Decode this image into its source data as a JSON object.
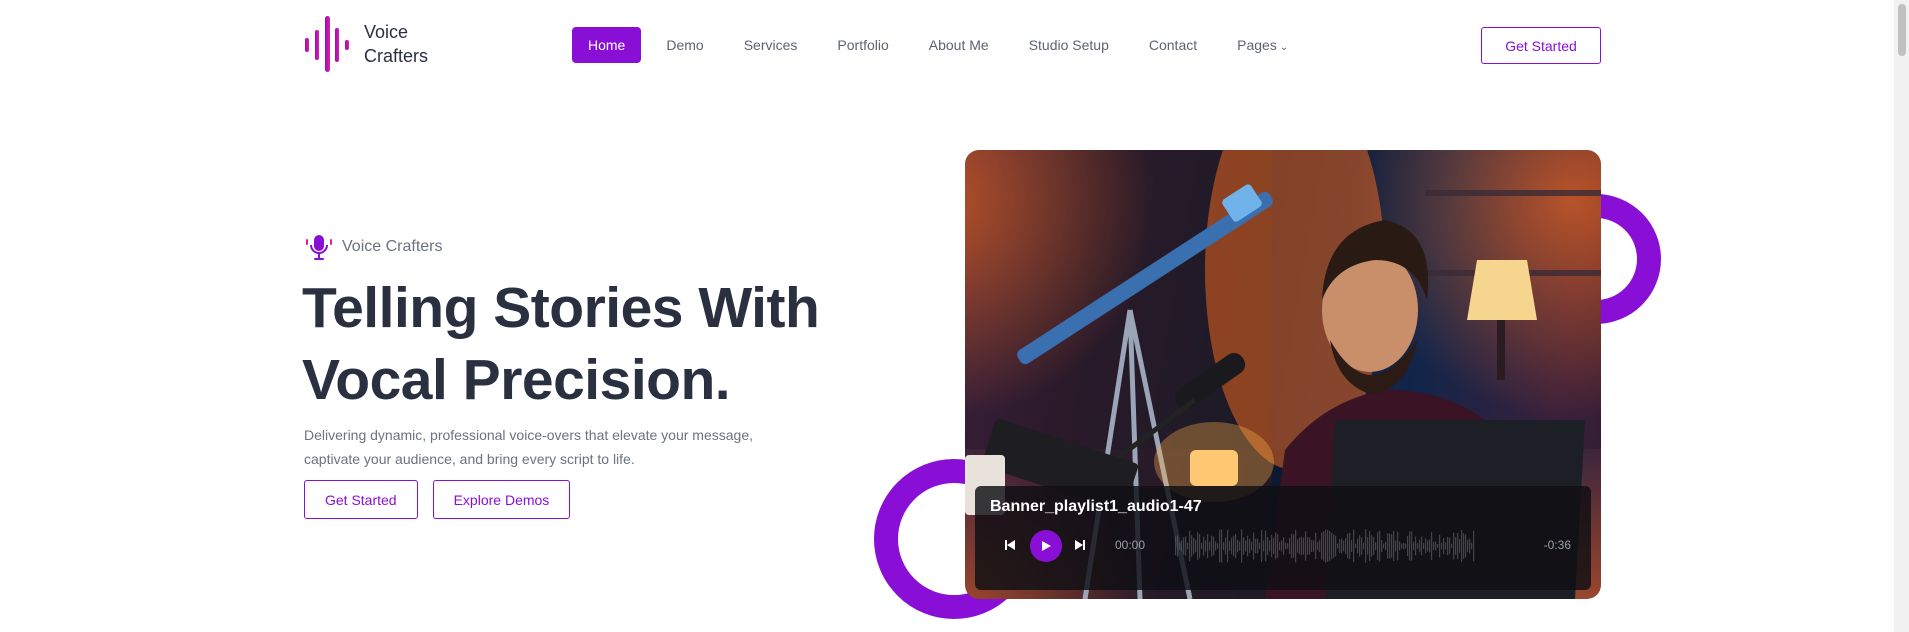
{
  "brand": {
    "name_line1": "Voice",
    "name_line2": "Crafters",
    "accent": "#8a0fd6",
    "accent_pink": "#e91e8c"
  },
  "nav": {
    "items": [
      {
        "label": "Home",
        "active": true
      },
      {
        "label": "Demo"
      },
      {
        "label": "Services"
      },
      {
        "label": "Portfolio"
      },
      {
        "label": "About Me"
      },
      {
        "label": "Studio Setup"
      },
      {
        "label": "Contact"
      },
      {
        "label": "Pages",
        "has_dropdown": true
      }
    ],
    "cta_label": "Get Started"
  },
  "hero": {
    "eyebrow": "Voice Crafters",
    "title_line1": "Telling Stories With",
    "title_line2": "Vocal Precision.",
    "subtitle_line1": "Delivering dynamic, professional voice-overs that elevate your message,",
    "subtitle_line2": "captivate your audience, and bring every script to life.",
    "primary_cta": "Get Started",
    "secondary_cta": "Explore Demos"
  },
  "player": {
    "track_title": "Banner_playlist1_audio1-47",
    "current_time": "00:00",
    "remaining_time": "-0:36"
  },
  "icons": {
    "logo": "waveform-logo-icon",
    "eyebrow": "microphone-icon",
    "prev": "skip-previous-icon",
    "play": "play-icon",
    "next": "skip-next-icon",
    "dropdown": "chevron-down-icon"
  }
}
